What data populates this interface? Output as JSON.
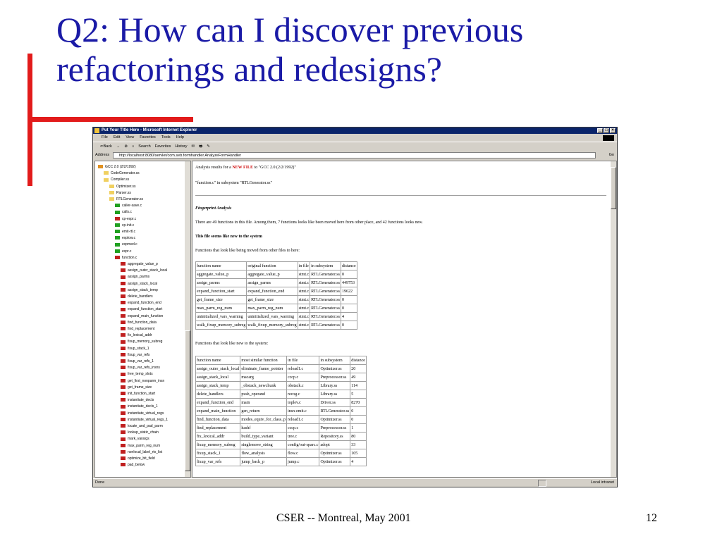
{
  "slide": {
    "title": "Q2: How can I discover previous refactorings and redesigns?",
    "footer_center": "CSER -- Montreal, May 2001",
    "page_number": "12"
  },
  "browser": {
    "window_title": "Put Your Title Here - Microsoft Internet Explorer",
    "window_buttons": [
      "_",
      "□",
      "×"
    ],
    "menu": [
      "File",
      "Edit",
      "View",
      "Favorites",
      "Tools",
      "Help"
    ],
    "toolbar": [
      "⇐Back",
      "→",
      "⊗",
      "⌂",
      "Search",
      "Favorites",
      "History",
      "✉",
      "🖶",
      "✎"
    ],
    "address_label": "Address",
    "address_url": "http://localhost:8080/servlet/com.seb.formhandler.AnalyzeFormHandler",
    "go_label": "Go",
    "status_text": "Done",
    "zone_text": "Local intranet"
  },
  "tree": [
    {
      "label": "GCC 2.0 (2/2/1992)",
      "indent": 0,
      "icon": "gcc-icon",
      "color": "#e09020"
    },
    {
      "label": "CodeGenerator.ss",
      "indent": 1,
      "icon": "folder-icon",
      "color": "#f0d060"
    },
    {
      "label": "Compiler.ss",
      "indent": 1,
      "icon": "folder-open-icon",
      "color": "#f0d060"
    },
    {
      "label": "Optimizer.ss",
      "indent": 2,
      "icon": "folder-icon",
      "color": "#f0d060"
    },
    {
      "label": "Parser.ss",
      "indent": 2,
      "icon": "folder-icon",
      "color": "#f0d060"
    },
    {
      "label": "RTLGenerator.ss",
      "indent": 2,
      "icon": "folder-open-icon",
      "color": "#f0d060"
    },
    {
      "label": "caller-save.c",
      "indent": 3,
      "icon": "file-icon",
      "color": "#20a020"
    },
    {
      "label": "calls.c",
      "indent": 3,
      "icon": "file-icon",
      "color": "#20a020"
    },
    {
      "label": "cp-expr.c",
      "indent": 3,
      "icon": "file-icon",
      "color": "#c02020"
    },
    {
      "label": "cp-init.c",
      "indent": 3,
      "icon": "file-icon",
      "color": "#20a020"
    },
    {
      "label": "emit-rtl.c",
      "indent": 3,
      "icon": "file-icon",
      "color": "#20a020"
    },
    {
      "label": "explow.c",
      "indent": 3,
      "icon": "file-icon",
      "color": "#20a020"
    },
    {
      "label": "expmed.c",
      "indent": 3,
      "icon": "file-icon",
      "color": "#20a020"
    },
    {
      "label": "expr.c",
      "indent": 3,
      "icon": "file-icon",
      "color": "#20a020"
    },
    {
      "label": "function.c",
      "indent": 3,
      "icon": "file-icon",
      "color": "#c02020"
    },
    {
      "label": "aggregate_value_p",
      "indent": 4,
      "icon": "function-icon",
      "color": "#c02020"
    },
    {
      "label": "assign_outer_stack_local",
      "indent": 4,
      "icon": "function-icon",
      "color": "#c02020"
    },
    {
      "label": "assign_parms",
      "indent": 4,
      "icon": "function-icon",
      "color": "#c02020"
    },
    {
      "label": "assign_stack_local",
      "indent": 4,
      "icon": "function-icon",
      "color": "#c02020"
    },
    {
      "label": "assign_stack_temp",
      "indent": 4,
      "icon": "function-icon",
      "color": "#c02020"
    },
    {
      "label": "delete_handlers",
      "indent": 4,
      "icon": "function-icon",
      "color": "#c02020"
    },
    {
      "label": "expand_function_end",
      "indent": 4,
      "icon": "function-icon",
      "color": "#c02020"
    },
    {
      "label": "expand_function_start",
      "indent": 4,
      "icon": "function-icon",
      "color": "#c02020"
    },
    {
      "label": "expand_main_function",
      "indent": 4,
      "icon": "function-icon",
      "color": "#c02020"
    },
    {
      "label": "find_function_data",
      "indent": 4,
      "icon": "function-icon",
      "color": "#c02020"
    },
    {
      "label": "find_replacement",
      "indent": 4,
      "icon": "function-icon",
      "color": "#c02020"
    },
    {
      "label": "fix_lexical_addr",
      "indent": 4,
      "icon": "function-icon",
      "color": "#c02020"
    },
    {
      "label": "fixup_memory_subreg",
      "indent": 4,
      "icon": "function-icon",
      "color": "#c02020"
    },
    {
      "label": "fixup_stack_1",
      "indent": 4,
      "icon": "function-icon",
      "color": "#c02020"
    },
    {
      "label": "fixup_var_refs",
      "indent": 4,
      "icon": "function-icon",
      "color": "#c02020"
    },
    {
      "label": "fixup_var_refs_1",
      "indent": 4,
      "icon": "function-icon",
      "color": "#c02020"
    },
    {
      "label": "fixup_var_refs_insns",
      "indent": 4,
      "icon": "function-icon",
      "color": "#c02020"
    },
    {
      "label": "free_temp_slots",
      "indent": 4,
      "icon": "function-icon",
      "color": "#c02020"
    },
    {
      "label": "get_first_nonparm_insn",
      "indent": 4,
      "icon": "function-icon",
      "color": "#c02020"
    },
    {
      "label": "get_frame_size",
      "indent": 4,
      "icon": "function-icon",
      "color": "#c02020"
    },
    {
      "label": "init_function_start",
      "indent": 4,
      "icon": "function-icon",
      "color": "#c02020"
    },
    {
      "label": "instantiate_decls",
      "indent": 4,
      "icon": "function-icon",
      "color": "#c02020"
    },
    {
      "label": "instantiate_decls_1",
      "indent": 4,
      "icon": "function-icon",
      "color": "#c02020"
    },
    {
      "label": "instantiate_virtual_regs",
      "indent": 4,
      "icon": "function-icon",
      "color": "#c02020"
    },
    {
      "label": "instantiate_virtual_regs_1",
      "indent": 4,
      "icon": "function-icon",
      "color": "#c02020"
    },
    {
      "label": "locate_and_pad_parm",
      "indent": 4,
      "icon": "function-icon",
      "color": "#c02020"
    },
    {
      "label": "lookup_static_chain",
      "indent": 4,
      "icon": "function-icon",
      "color": "#c02020"
    },
    {
      "label": "mark_varargs",
      "indent": 4,
      "icon": "function-icon",
      "color": "#c02020"
    },
    {
      "label": "max_parm_reg_num",
      "indent": 4,
      "icon": "function-icon",
      "color": "#c02020"
    },
    {
      "label": "nonlocal_label_rtx_list",
      "indent": 4,
      "icon": "function-icon",
      "color": "#c02020"
    },
    {
      "label": "optimize_bit_field",
      "indent": 4,
      "icon": "function-icon",
      "color": "#c02020"
    },
    {
      "label": "pad_below",
      "indent": 4,
      "icon": "function-icon",
      "color": "#c02020"
    }
  ],
  "content": {
    "analysis_prefix": "Analysis results for a ",
    "new_file": "NEW FILE",
    "analysis_suffix": " to \"GCC 2.0 (2/2/1992)\"",
    "subsystem_line": "\"function.c\" in subsystem \"RTLGenerator.ss\"",
    "fingerprint_heading": "Fingerprint Analysis",
    "functions_count_text": "There are 49 functions in this file. Among them, 7 functions looks like been moved here from other place, and 42 functions looks new.",
    "new_file_heading": "This file seems like new to the system",
    "moved_intro": "Functions that look like being moved from other files to here:",
    "new_intro": "Functions that look like new to the system:",
    "moved_table": {
      "headers": [
        "function name",
        "original function",
        "in file",
        "in subsystem",
        "distance"
      ],
      "rows": [
        [
          "aggregate_value_p",
          "aggregate_value_p",
          "stmt.c",
          "RTLGenerator.ss",
          "0"
        ],
        [
          "assign_parms",
          "assign_parms",
          "stmt.c",
          "RTLGenerator.ss",
          "449753"
        ],
        [
          "expand_function_start",
          "expand_function_end",
          "stmt.c",
          "RTLGenerator.ss",
          "19622"
        ],
        [
          "get_frame_size",
          "get_frame_size",
          "stmt.c",
          "RTLGenerator.ss",
          "0"
        ],
        [
          "max_parm_reg_num",
          "max_parm_reg_num",
          "stmt.c",
          "RTLGenerator.ss",
          "0"
        ],
        [
          "uninitialized_vars_warning",
          "uninitialized_vars_warning",
          "stmt.c",
          "RTLGenerator.ss",
          "4"
        ],
        [
          "walk_fixup_memory_subreg",
          "walk_fixup_memory_subreg",
          "stmt.c",
          "RTLGenerator.ss",
          "0"
        ]
      ]
    },
    "new_table": {
      "headers": [
        "function name",
        "most similar function",
        "in file",
        "in subsystem",
        "distance"
      ],
      "rows": [
        [
          "assign_outer_stack_local",
          "eliminate_frame_pointer",
          "reload1.c",
          "Optimizer.ss",
          "20"
        ],
        [
          "assign_stack_local",
          "macarg",
          "cccp.c",
          "Preprocessor.ss",
          "49"
        ],
        [
          "assign_stack_temp",
          "_obstack_newchunk",
          "obstack.c",
          "Library.ss",
          "114"
        ],
        [
          "delete_handlers",
          "push_operand",
          "recog.c",
          "Library.ss",
          "5"
        ],
        [
          "expand_function_end",
          "main",
          "toplev.c",
          "Driver.ss",
          "8270"
        ],
        [
          "expand_main_function",
          "gen_return",
          "insn-emit.c",
          "RTLGenerator.ss",
          "0"
        ],
        [
          "find_function_data",
          "modes_equiv_for_class_p",
          "reload1.c",
          "Optimizer.ss",
          "0"
        ],
        [
          "find_replacement",
          "hashf",
          "cccp.c",
          "Preprocessor.ss",
          "1"
        ],
        [
          "fix_lexical_addr",
          "build_type_variant",
          "tree.c",
          "Repository.ss",
          "80"
        ],
        [
          "fixup_memory_subreg",
          "singlemove_string",
          "config/out-sparc.c",
          "adopt",
          "33"
        ],
        [
          "fixup_stack_1",
          "flow_analysis",
          "flow.c",
          "Optimizer.ss",
          "105"
        ],
        [
          "fixup_var_refs",
          "jump_back_p",
          "jump.c",
          "Optimizer.ss",
          "4"
        ]
      ]
    }
  }
}
